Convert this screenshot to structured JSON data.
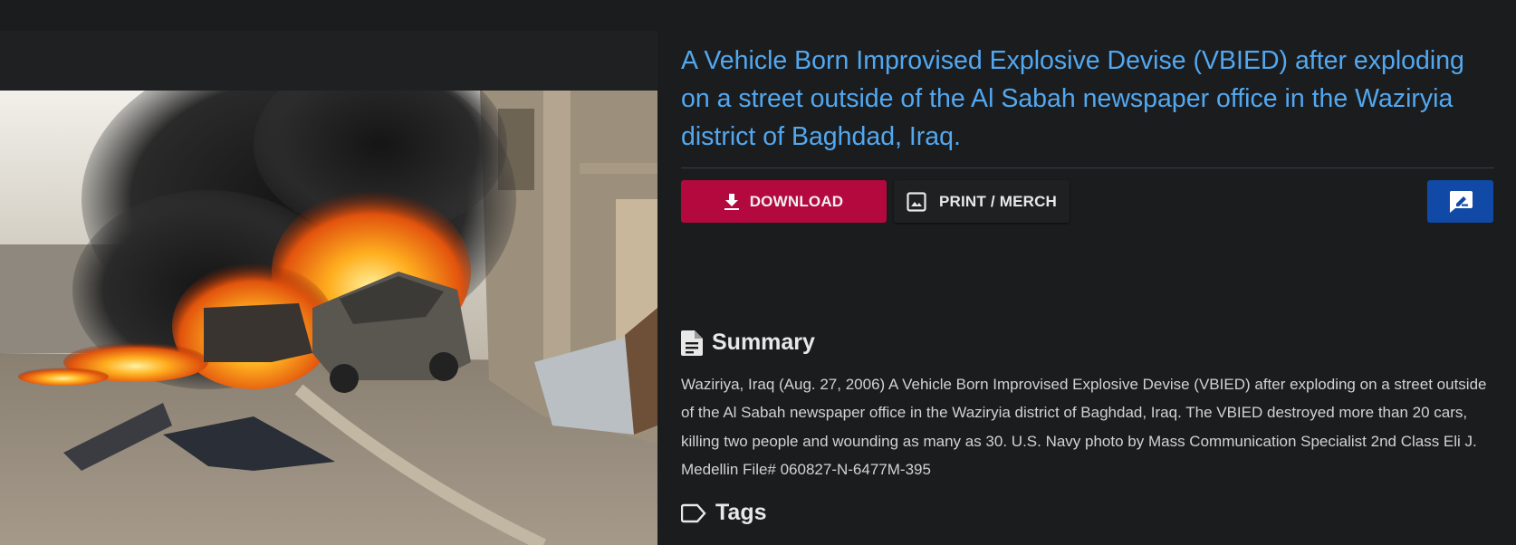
{
  "image": {
    "alt_icon": "photo-of-burning-vehicles"
  },
  "header": {
    "title": "A Vehicle Born Improvised Explosive Devise (VBIED) after exploding on a street outside of the Al Sabah newspaper office in the Waziryia district of Baghdad, Iraq."
  },
  "actions": {
    "download_label": "DOWNLOAD",
    "download_icon": "download-icon",
    "print_label": "PRINT / MERCH",
    "print_icon": "image-icon",
    "feedback_icon": "feedback-icon"
  },
  "summary": {
    "heading": "Summary",
    "icon": "document-icon",
    "text": "Waziriya, Iraq (Aug. 27, 2006) A Vehicle Born Improvised Explosive Devise (VBIED) after exploding on a street outside of the Al Sabah newspaper office in the Waziryia district of Baghdad, Iraq. The VBIED destroyed more than 20 cars, killing two people and wounding as many as 30. U.S. Navy photo by Mass Communication Specialist 2nd Class Eli J. Medellin File# 060827-N-6477M-395"
  },
  "tags": {
    "heading": "Tags",
    "icon": "tag-icon"
  },
  "colors": {
    "background": "#1b1c1e",
    "title": "#52a8f0",
    "download_button": "#b3093e",
    "feedback_button": "#1149a6"
  }
}
